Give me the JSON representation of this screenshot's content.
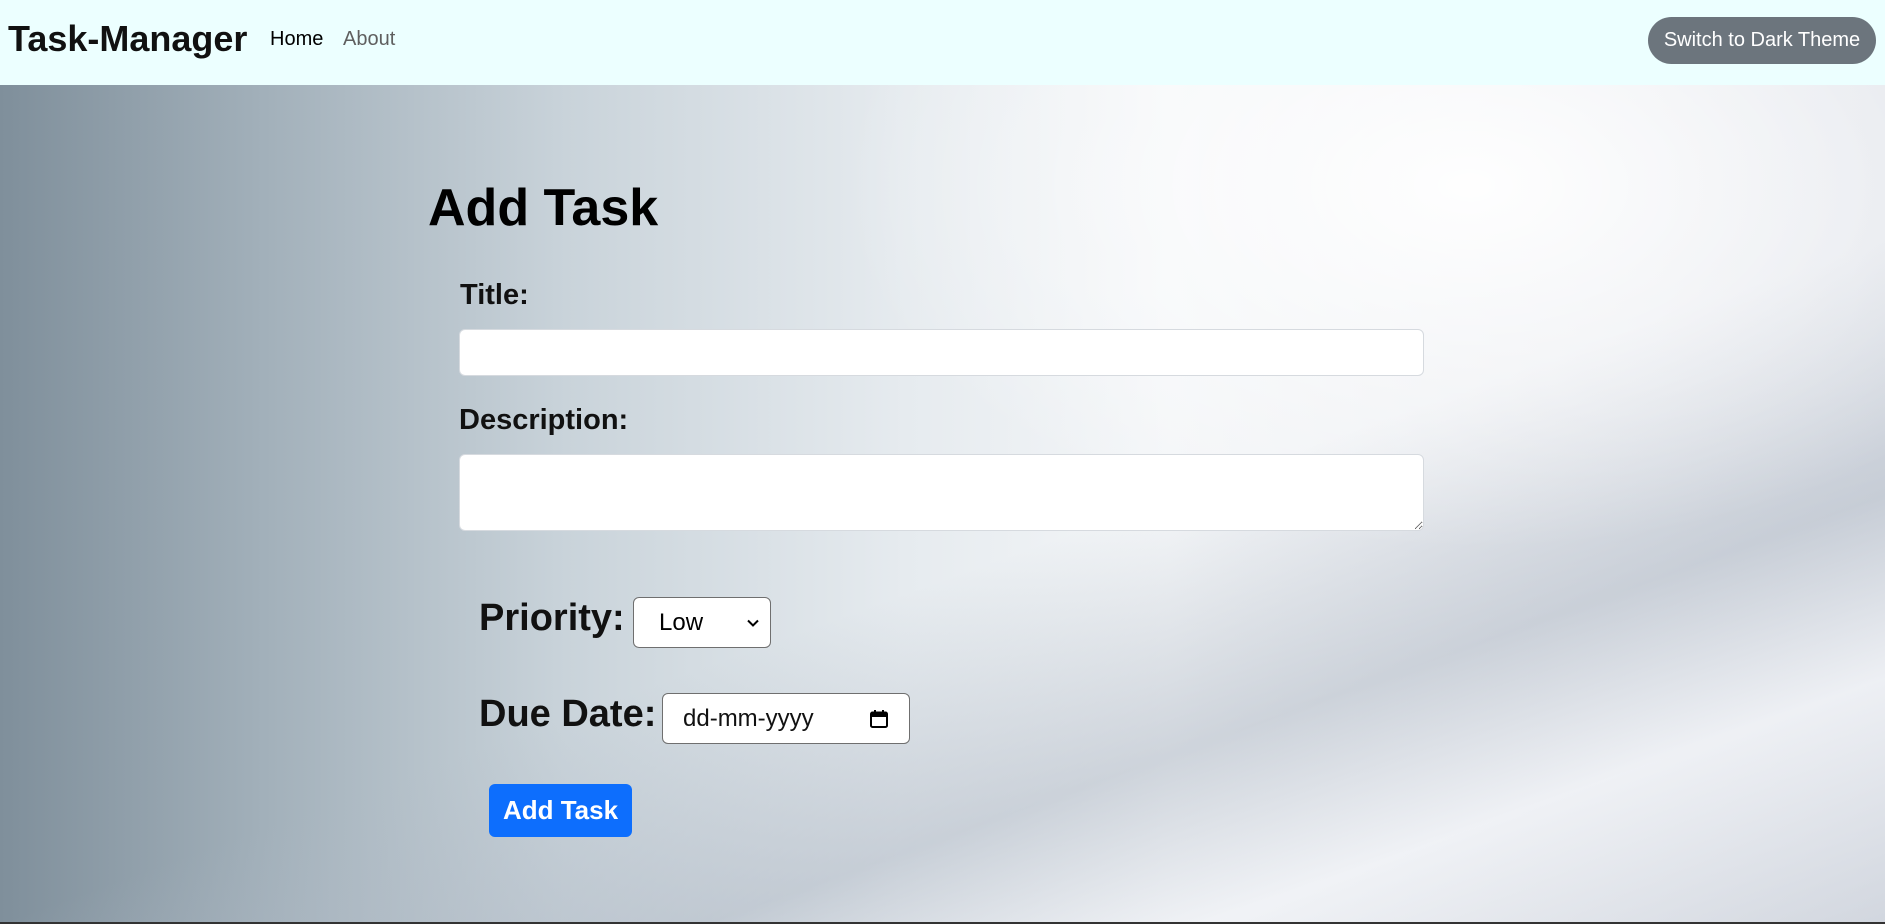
{
  "navbar": {
    "brand": "Task-Manager",
    "links": [
      {
        "label": "Home"
      },
      {
        "label": "About"
      }
    ],
    "theme_button": "Switch to Dark Theme"
  },
  "form": {
    "heading": "Add Task",
    "title_label": "Title:",
    "title_value": "",
    "description_label": "Description:",
    "description_value": "",
    "priority_label": "Priority:",
    "priority_selected": "Low",
    "due_date_label": "Due Date:",
    "due_date_placeholder": "dd-mm-yyyy",
    "submit_label": "Add Task"
  },
  "colors": {
    "navbar_bg": "#ecffff",
    "theme_button_bg": "#6c757d",
    "primary": "#0d6efd"
  },
  "icons": {
    "select_arrow": "chevron-down-icon",
    "date_picker": "calendar-icon"
  }
}
